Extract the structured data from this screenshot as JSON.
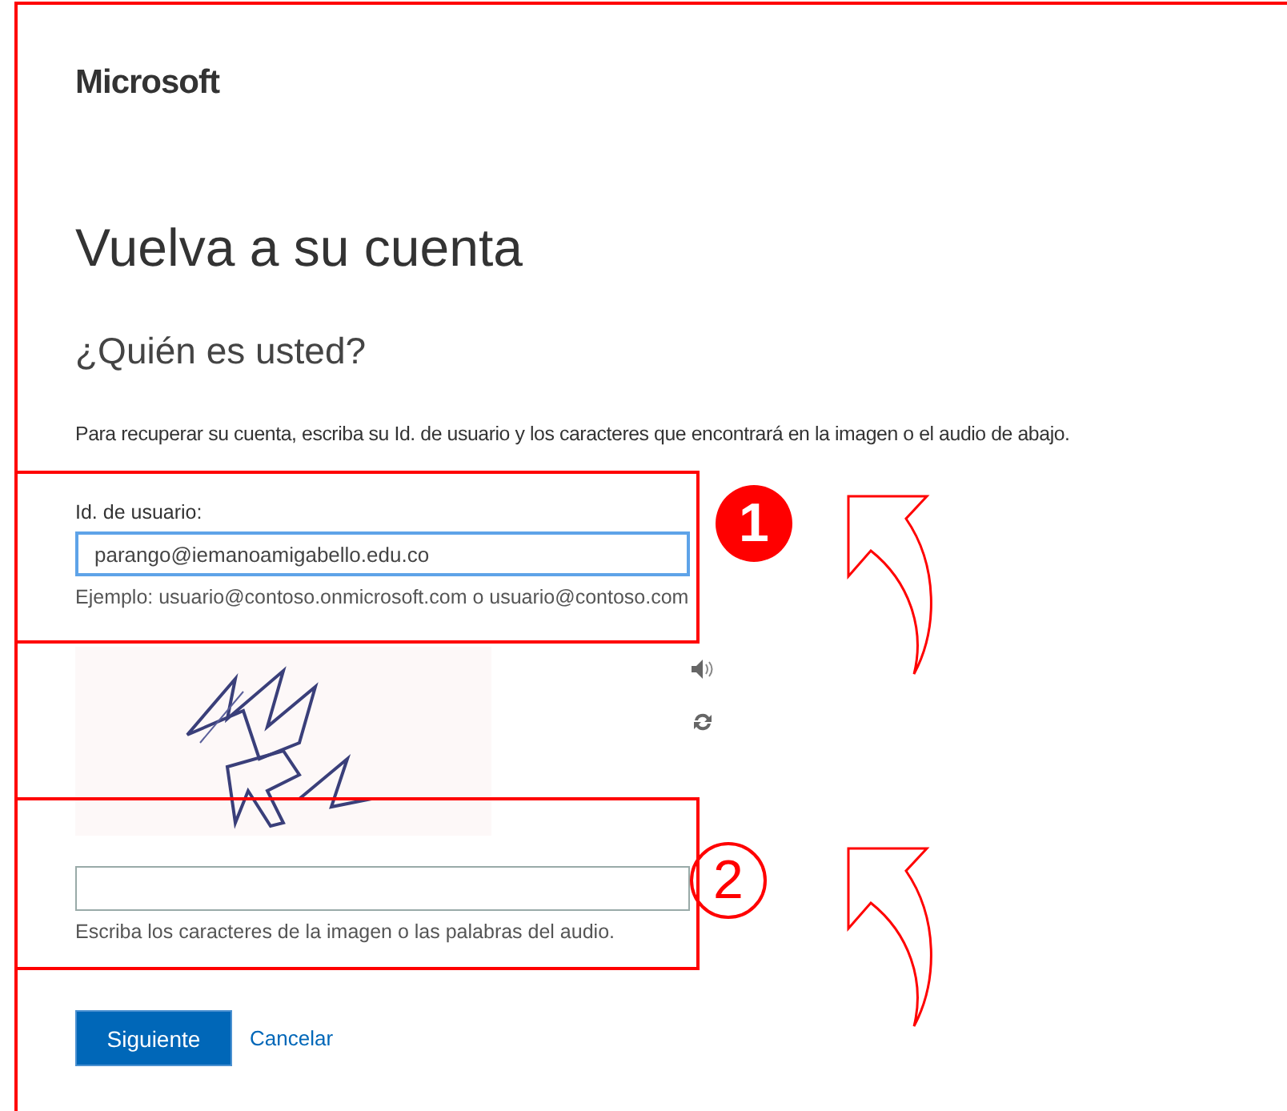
{
  "logo": "Microsoft",
  "title": "Vuelva a su cuenta",
  "subtitle": "¿Quién es usted?",
  "instructions": "Para recuperar su cuenta, escriba su Id. de usuario y los caracteres que encontrará en la imagen o el audio de abajo.",
  "user_id": {
    "label": "Id. de usuario:",
    "value": "parango@iemanoamigabello.edu.co",
    "hint": "Ejemplo: usuario@contoso.onmicrosoft.com o usuario@contoso.com"
  },
  "captcha": {
    "kind": "picture",
    "hint": "Escriba los caracteres de la imagen o las palabras del audio."
  },
  "buttons": {
    "next": "Siguiente",
    "cancel": "Cancelar"
  },
  "callouts": [
    {
      "number": "1",
      "kind": "filled"
    },
    {
      "number": "2",
      "kind": "outline"
    }
  ]
}
